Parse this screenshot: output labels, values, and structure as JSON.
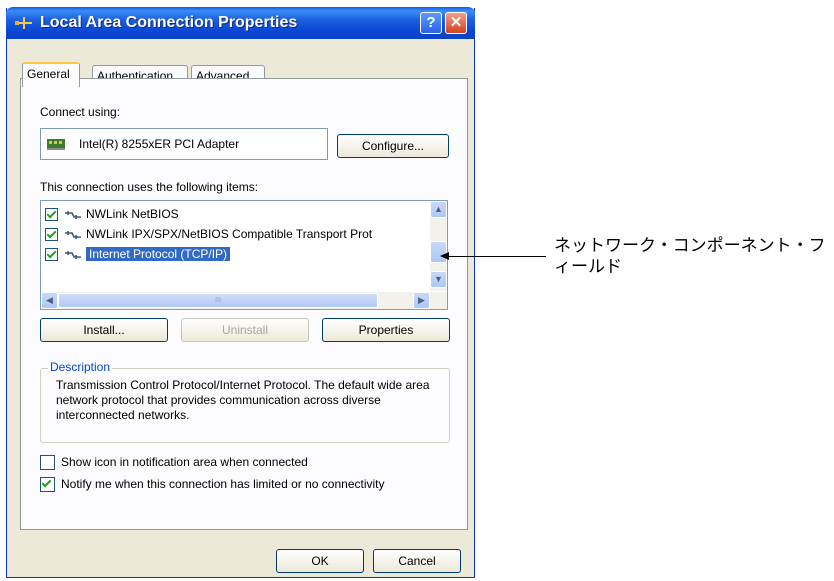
{
  "window": {
    "title": "Local Area Connection Properties",
    "help_symbol": "?",
    "close_symbol": "✕"
  },
  "tabs": [
    {
      "label": "General",
      "active": true
    },
    {
      "label": "Authentication",
      "active": false
    },
    {
      "label": "Advanced",
      "active": false
    }
  ],
  "connect_using": {
    "label": "Connect using:",
    "adapter": "Intel(R) 8255xER PCI Adapter",
    "configure_button": "Configure..."
  },
  "components": {
    "label": "This connection uses the following items:",
    "items": [
      {
        "label": "NWLink NetBIOS",
        "checked": true,
        "selected": false
      },
      {
        "label": "NWLink IPX/SPX/NetBIOS Compatible Transport Prot",
        "checked": true,
        "selected": false
      },
      {
        "label": "Internet Protocol (TCP/IP)",
        "checked": true,
        "selected": true
      }
    ],
    "scroll_track_glyph": "III"
  },
  "buttons": {
    "install": "Install...",
    "uninstall": "Uninstall",
    "properties": "Properties",
    "ok": "OK",
    "cancel": "Cancel"
  },
  "description": {
    "title": "Description",
    "text": "Transmission Control Protocol/Internet Protocol. The default wide area network protocol that provides communication across diverse interconnected networks."
  },
  "options": [
    {
      "label": "Show icon in notification area when connected",
      "checked": false
    },
    {
      "label": "Notify me when this connection has limited or no connectivity",
      "checked": true
    }
  ],
  "annotation": {
    "text": "ネットワーク・コンポーネント・フィールド"
  },
  "colors": {
    "selection": "#316ac5",
    "titlebar": "#0a47d6",
    "dialog_bg": "#ece9d8"
  }
}
